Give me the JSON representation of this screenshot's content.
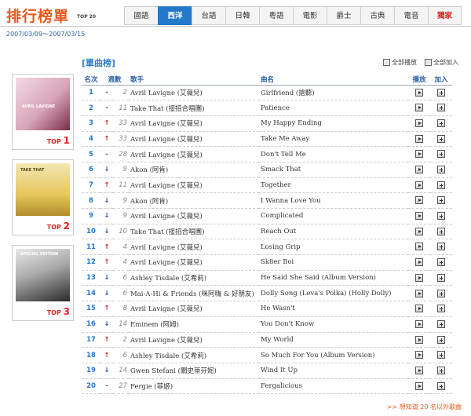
{
  "header": {
    "logo": "排行榜單",
    "logo_sub": "TOP 20",
    "tabs": [
      {
        "label": "國語",
        "active": false
      },
      {
        "label": "西洋",
        "active": true
      },
      {
        "label": "台語",
        "active": false
      },
      {
        "label": "日韓",
        "active": false
      },
      {
        "label": "粵語",
        "active": false
      },
      {
        "label": "電影",
        "active": false
      },
      {
        "label": "爵士",
        "active": false
      },
      {
        "label": "古典",
        "active": false
      },
      {
        "label": "電音",
        "active": false
      },
      {
        "label": "獨家",
        "active": false
      }
    ]
  },
  "date_range": "2007/03/09～2007/03/15",
  "section": {
    "title": "[單曲榜]",
    "play_all": "全部播放",
    "add_all": "全部加入"
  },
  "covers": [
    {
      "label": "TOP",
      "num": "1",
      "art_text": "AVRIL LAVIGNE"
    },
    {
      "label": "TOP",
      "num": "2",
      "art_text": "TAKE THAT"
    },
    {
      "label": "TOP",
      "num": "3",
      "art_text": "SPECIAL EDITION"
    }
  ],
  "table": {
    "headers": {
      "rank": "名次",
      "weeks": "週數",
      "artist": "歌手",
      "title": "曲名",
      "play": "播放",
      "add": "加入"
    },
    "rows": [
      {
        "rank": "1",
        "trend": "-",
        "prev": "2",
        "artist": "Avril Lavigne (艾薇兒)",
        "title": "Girlfriend (搶聽)"
      },
      {
        "rank": "2",
        "trend": "-",
        "prev": "11",
        "artist": "Take That (接招合唱團)",
        "title": "Patience"
      },
      {
        "rank": "3",
        "trend": "↑",
        "prev": "33",
        "artist": "Avril Lavigne (艾薇兒)",
        "title": "My Happy Ending"
      },
      {
        "rank": "4",
        "trend": "↑",
        "prev": "33",
        "artist": "Avril Lavigne (艾薇兒)",
        "title": "Take Me Away"
      },
      {
        "rank": "5",
        "trend": "-",
        "prev": "28",
        "artist": "Avril Lavigne (艾薇兒)",
        "title": "Don't Tell Me"
      },
      {
        "rank": "6",
        "trend": "↓",
        "prev": "9",
        "artist": "Akon (阿肯)",
        "title": "Smack That"
      },
      {
        "rank": "7",
        "trend": "↑",
        "prev": "11",
        "artist": "Avril Lavigne (艾薇兒)",
        "title": "Together"
      },
      {
        "rank": "8",
        "trend": "↓",
        "prev": "9",
        "artist": "Akon (阿肯)",
        "title": "I Wanna Love You"
      },
      {
        "rank": "9",
        "trend": "↓",
        "prev": "9",
        "artist": "Avril Lavigne (艾薇兒)",
        "title": "Complicated"
      },
      {
        "rank": "10",
        "trend": "↓",
        "prev": "10",
        "artist": "Take That (接招合唱團)",
        "title": "Reach Out"
      },
      {
        "rank": "11",
        "trend": "↑",
        "prev": "4",
        "artist": "Avril Lavigne (艾薇兒)",
        "title": "Losing Grip"
      },
      {
        "rank": "12",
        "trend": "↑",
        "prev": "4",
        "artist": "Avril Lavigne (艾薇兒)",
        "title": "Sk8er Boi"
      },
      {
        "rank": "13",
        "trend": "↓",
        "prev": "6",
        "artist": "Ashley Tisdale (艾希莉)",
        "title": "He Said She Said (Album Version)"
      },
      {
        "rank": "14",
        "trend": "↓",
        "prev": "6",
        "artist": "Mai-A-Hi & Friends (咪阿嗨 & 好朋友)",
        "title": "Dolly Song (Leva's Polka) (Holly Dolly)"
      },
      {
        "rank": "15",
        "trend": "↑",
        "prev": "8",
        "artist": "Avril Lavigne (艾薇兒)",
        "title": "He Wasn't"
      },
      {
        "rank": "16",
        "trend": "↓",
        "prev": "14",
        "artist": "Eminem (阿姆)",
        "title": "You Don't Know"
      },
      {
        "rank": "17",
        "trend": "↑",
        "prev": "2",
        "artist": "Avril Lavigne (艾薇兒)",
        "title": "My World"
      },
      {
        "rank": "18",
        "trend": "↑",
        "prev": "6",
        "artist": "Ashley Tisdale (艾希莉)",
        "title": "So Much For You (Album Version)"
      },
      {
        "rank": "19",
        "trend": "↓",
        "prev": "14",
        "artist": "Gwen Stefani (關史蒂芬妮)",
        "title": "Wind It Up"
      },
      {
        "rank": "20",
        "trend": "-",
        "prev": "27",
        "artist": "Fergie (菲姬)",
        "title": "Fergalicious"
      }
    ]
  },
  "more_link": ">> 想知道 20 名以外歌曲",
  "colors": {
    "accent": "#2478c9",
    "logo": "#e8581f",
    "up": "#e02424",
    "down": "#2250b0"
  }
}
